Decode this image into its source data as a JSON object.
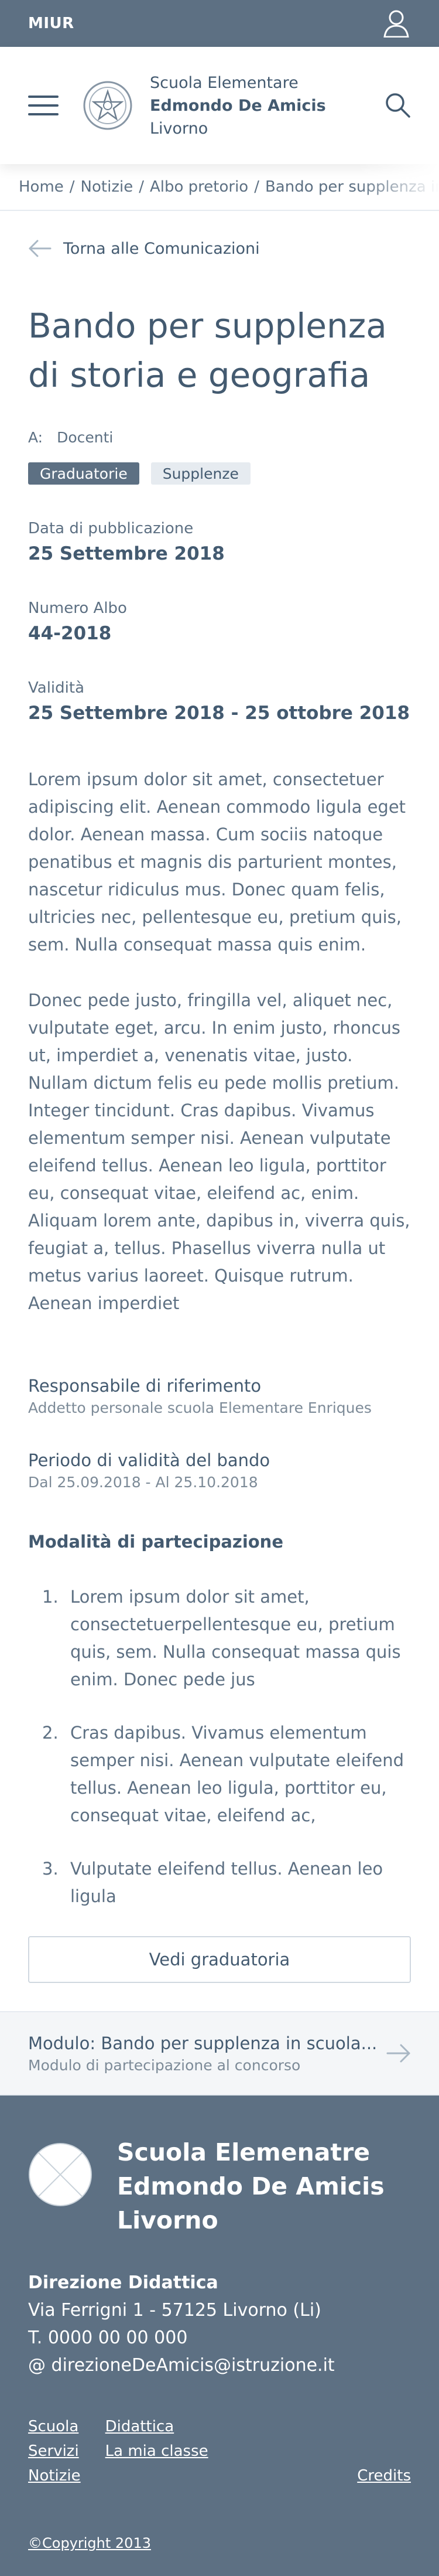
{
  "topbar": {
    "brand": "MIUR",
    "user_icon": "user-icon"
  },
  "header": {
    "school_line1": "Scuola Elementare",
    "school_line2": "Edmondo De Amicis",
    "school_line3": "Livorno",
    "menu_icon": "hamburger-icon",
    "search_icon": "search-icon"
  },
  "breadcrumb": {
    "items": [
      "Home",
      "Notizie",
      "Albo pretorio",
      "Bando per supplenza in scuola elementare"
    ]
  },
  "back_link": {
    "label": "Torna alle Comunicazioni",
    "icon": "arrow-left-icon"
  },
  "article": {
    "title": "Bando per supplenza di storia e geografia",
    "target_label": "A:",
    "target_value": "Docenti",
    "tags": [
      "Graduatorie",
      "Supplenze"
    ],
    "meta": [
      {
        "label": "Data di pubblicazione",
        "value": "25 Settembre 2018"
      },
      {
        "label": "Numero Albo",
        "value": "44-2018"
      },
      {
        "label": "Validità",
        "value": "25 Settembre 2018 - 25 ottobre 2018"
      }
    ],
    "paragraphs": [
      "Lorem ipsum dolor sit amet, consectetuer adipiscing elit. Aenean commodo ligula eget dolor. Aenean massa. Cum sociis natoque penatibus et magnis dis parturient montes, nascetur ridiculus mus. Donec quam felis, ultricies nec, pellentesque eu, pretium quis, sem. Nulla consequat massa quis enim.",
      "Donec pede justo, fringilla vel, aliquet nec, vulputate eget, arcu. In enim justo, rhoncus ut, imperdiet a, venenatis vitae, justo. Nullam dictum felis eu pede mollis pretium. Integer tincidunt. Cras dapibus. Vivamus elementum semper nisi. Aenean vulputate eleifend tellus. Aenean leo ligula, porttitor eu, consequat vitae, eleifend ac, enim. Aliquam lorem ante, dapibus in, viverra quis, feugiat a, tellus. Phasellus viverra nulla ut metus varius laoreet. Quisque rutrum. Aenean imperdiet"
    ],
    "info": [
      {
        "label": "Responsabile di riferimento",
        "sub": "Addetto personale scuola Elementare Enriques"
      },
      {
        "label": "Periodo di validità del bando",
        "sub": "Dal 25.09.2018 - Al 25.10.2018"
      }
    ],
    "participation_title": "Modalità di partecipazione",
    "steps": [
      {
        "num": "1.",
        "text": "Lorem ipsum dolor sit amet, consectetuerpellentesque eu, pretium quis, sem. Nulla consequat massa quis enim. Donec pede jus"
      },
      {
        "num": "2.",
        "text": "Cras dapibus. Vivamus elementum semper nisi. Aenean vulputate eleifend tellus. Aenean leo ligula, porttitor eu, consequat vitae, eleifend ac,"
      },
      {
        "num": "3.",
        "text": "Vulputate eleifend tellus. Aenean leo ligula"
      }
    ],
    "cta_label": "Vedi graduatoria"
  },
  "module": {
    "title": "Modulo: Bando per supplenza in scuola...",
    "subtitle": "Modulo di partecipazione al concorso",
    "icon": "arrow-right-icon"
  },
  "footer": {
    "school_line1": "Scuola Elemenatre",
    "school_line2": "Edmondo De Amicis",
    "school_line3": "Livorno",
    "contacts_title": "Direzione Didattica",
    "address": "Via Ferrigni 1 - 57125 Livorno (Li)",
    "phone": "T. 0000 00 00 000",
    "email": "@ direzioneDeAmicis@istruzione.it",
    "links_col1": [
      "Scuola",
      "Servizi",
      "Notizie"
    ],
    "links_col2": [
      "Didattica",
      "La mia classe"
    ],
    "credits": "Credits",
    "copyright": "©Copyright 2013"
  },
  "colors": {
    "primary": "#5d7083",
    "text": "#435a70",
    "light_bg": "#e6ebf0"
  }
}
